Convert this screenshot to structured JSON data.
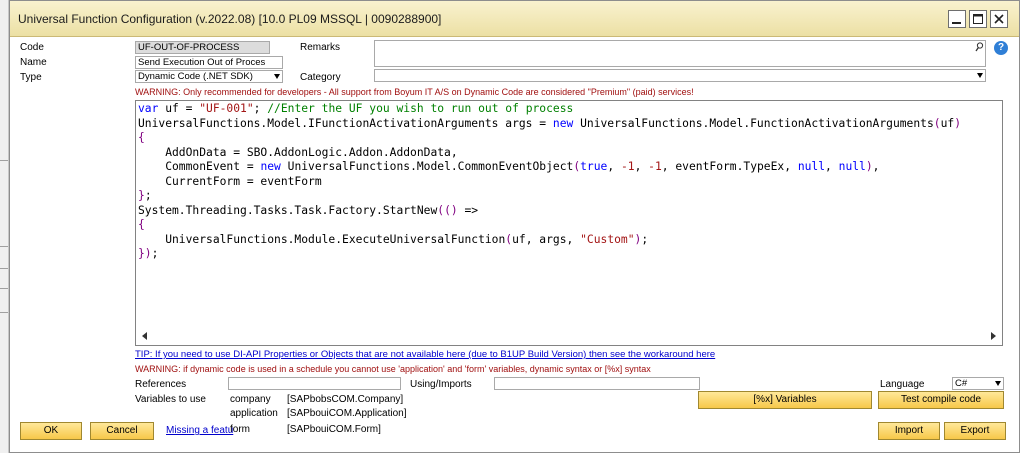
{
  "window": {
    "title": "Universal Function Configuration (v.2022.08) [10.0 PL09 MSSQL | 0090288900]"
  },
  "header": {
    "code_label": "Code",
    "code_value": "UF-OUT-OF-PROCESS",
    "name_label": "Name",
    "name_value": "Send Execution Out of Proces",
    "type_label": "Type",
    "type_value": "Dynamic Code (.NET SDK)",
    "remarks_label": "Remarks",
    "remarks_value": "",
    "category_label": "Category",
    "category_value": ""
  },
  "warning_top": "WARNING: Only recommended for developers - All support from Boyum IT A/S on Dynamic Code are considered \"Premium\" (paid) services!",
  "editor": {
    "lines": [
      "var uf = \"UF-001\"; //Enter the UF you wish to run out of process",
      "UniversalFunctions.Model.IFunctionActivationArguments args = new UniversalFunctions.Model.FunctionActivationArguments(uf)",
      "{",
      "    AddOnData = SBO.AddonLogic.Addon.AddonData,",
      "    CommonEvent = new UniversalFunctions.Model.CommonEventObject(true, -1, -1, eventForm.TypeEx, null, null),",
      "    CurrentForm = eventForm",
      "};",
      "System.Threading.Tasks.Task.Factory.StartNew(() =>",
      "{",
      "    UniversalFunctions.Module.ExecuteUniversalFunction(uf, args, \"Custom\");",
      "});"
    ]
  },
  "tip_text": "TIP: If you need to use DI-API Properties or Objects that are not available here (due to B1UP Build Version) then see the workaround here",
  "warning_bottom": "WARNING: if dynamic code is used in a schedule you cannot use 'application' and 'form' variables, dynamic syntax or [%x] syntax",
  "footer": {
    "references_label": "References",
    "references_value": "",
    "using_label": "Using/Imports",
    "using_value": "",
    "language_label": "Language",
    "language_value": "C#",
    "variables_label": "Variables to use",
    "variables": [
      {
        "name": "company",
        "type": "[SAPbobsCOM.Company]"
      },
      {
        "name": "application",
        "type": "[SAPbouiCOM.Application]"
      },
      {
        "name": "form",
        "type": "[SAPbouiCOM.Form]"
      }
    ],
    "missing_feature_link": "Missing a featu",
    "variables_button": "[%x] Variables",
    "test_compile_button": "Test compile code",
    "ok_button": "OK",
    "cancel_button": "Cancel",
    "import_button": "Import",
    "export_button": "Export"
  },
  "colors": {
    "title_bar": "#f1e6b0",
    "button": "#f9d469",
    "warning": "#a01010",
    "link": "#0000cc",
    "keyword": "#0000ff",
    "comment": "#008000",
    "string": "#a31515"
  }
}
